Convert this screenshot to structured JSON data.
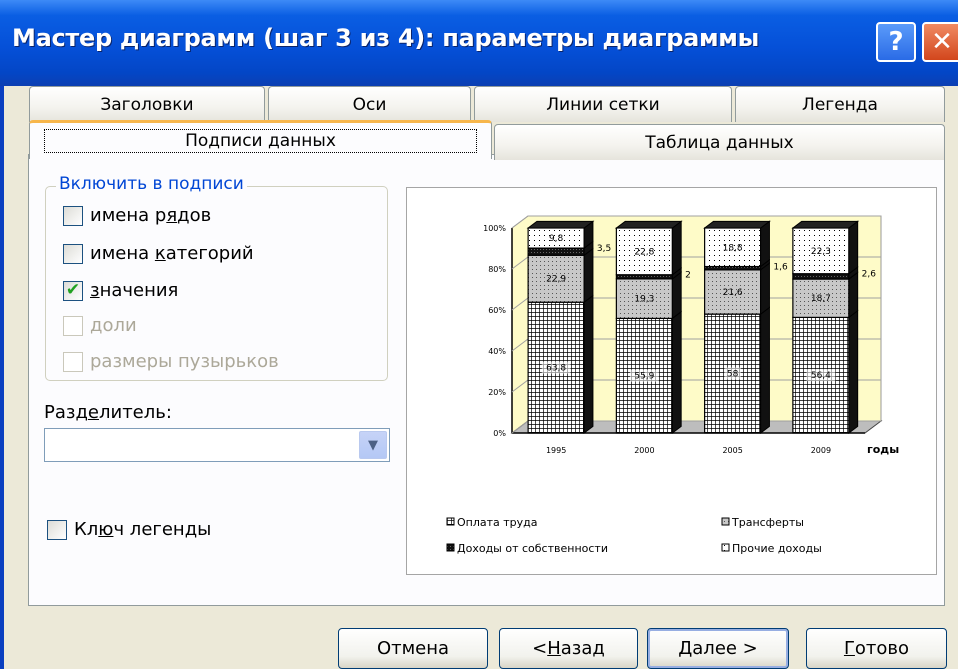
{
  "window": {
    "title": "Мастер диаграмм (шаг 3 из 4): параметры диаграммы",
    "help_glyph": "?",
    "close_glyph": "✕"
  },
  "tabs_row1": [
    "Заголовки",
    "Оси",
    "Линии сетки",
    "Легенда"
  ],
  "tabs_row2": {
    "active": "Подписи данных",
    "other": "Таблица данных"
  },
  "include_group": {
    "legend": "Включить в подписи",
    "options": [
      {
        "label": "имена рядов",
        "pre": "имена р",
        "key": "я",
        "post": "дов",
        "checked": false,
        "enabled": true
      },
      {
        "label": "имена категорий",
        "pre": "имена ",
        "key": "к",
        "post": "атегорий",
        "checked": false,
        "enabled": true
      },
      {
        "label": "значения",
        "pre": "",
        "key": "з",
        "post": "начения",
        "checked": true,
        "enabled": true
      },
      {
        "label": "доли",
        "pre": "доли",
        "key": "",
        "post": "",
        "checked": false,
        "enabled": false
      },
      {
        "label": "размеры пузырьков",
        "pre": "размеры пузырьков",
        "key": "",
        "post": "",
        "checked": false,
        "enabled": false
      }
    ]
  },
  "separator": {
    "label_pre": "Разд",
    "label_key": "е",
    "label_post": "литель:",
    "value": ""
  },
  "legend_key": {
    "pre": "Кл",
    "key": "ю",
    "post": "ч легенды",
    "checked": false
  },
  "buttons": {
    "cancel": "Отмена",
    "back": {
      "pre": "< ",
      "key": "Н",
      "post": "азад"
    },
    "next": {
      "pre": "",
      "key": "Д",
      "post": "алее >"
    },
    "finish": {
      "pre": "",
      "key": "Г",
      "post": "отово"
    }
  },
  "colors": {
    "title_bar": "#0550d8",
    "group_legend": "#0046d5",
    "check": "#21a121",
    "active_tab_accent": "#f7b64b",
    "chart_wall": "#fefbc8"
  },
  "chart_data": {
    "type": "bar",
    "stacked": "100%",
    "categories": [
      "1995",
      "2000",
      "2005",
      "2009"
    ],
    "xlabel": "годы",
    "yticks": [
      "0%",
      "20%",
      "40%",
      "60%",
      "80%",
      "100%"
    ],
    "ylim": [
      0,
      100
    ],
    "series": [
      {
        "name": "Оплата труда",
        "values": [
          63.8,
          55.9,
          58,
          56.4
        ],
        "labels": [
          "63,8",
          "55,9",
          "58",
          "56,4"
        ],
        "pattern": "grid"
      },
      {
        "name": "Трансферты",
        "values": [
          22.9,
          19.3,
          21.6,
          18.7
        ],
        "labels": [
          "22,9",
          "19,3",
          "21,6",
          "18,7"
        ],
        "pattern": "dots-gray"
      },
      {
        "name": "Доходы от собственности",
        "values": [
          3.5,
          2,
          1.6,
          2.6
        ],
        "labels": [
          "3,5",
          "2",
          "1,6",
          "2,6"
        ],
        "pattern": "dark"
      },
      {
        "name": "Прочие доходы",
        "values": [
          9.8,
          22.8,
          18.8,
          22.3
        ],
        "labels": [
          "9,8",
          "22,8",
          "18,8",
          "22,3"
        ],
        "pattern": "dots-white"
      }
    ],
    "legend_entries": [
      "Оплата труда",
      "Трансферты",
      "Доходы от собственности",
      "Прочие доходы"
    ],
    "legend_placement": "bottom",
    "grid": true
  }
}
